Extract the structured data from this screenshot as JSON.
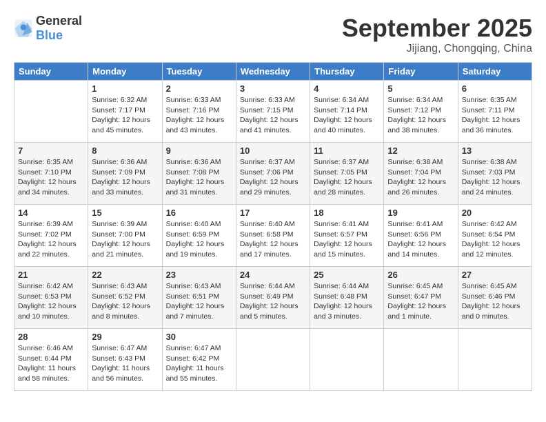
{
  "logo": {
    "general": "General",
    "blue": "Blue"
  },
  "title": "September 2025",
  "subtitle": "Jijiang, Chongqing, China",
  "days_of_week": [
    "Sunday",
    "Monday",
    "Tuesday",
    "Wednesday",
    "Thursday",
    "Friday",
    "Saturday"
  ],
  "weeks": [
    [
      {
        "day": "",
        "info": ""
      },
      {
        "day": "1",
        "info": "Sunrise: 6:32 AM\nSunset: 7:17 PM\nDaylight: 12 hours\nand 45 minutes."
      },
      {
        "day": "2",
        "info": "Sunrise: 6:33 AM\nSunset: 7:16 PM\nDaylight: 12 hours\nand 43 minutes."
      },
      {
        "day": "3",
        "info": "Sunrise: 6:33 AM\nSunset: 7:15 PM\nDaylight: 12 hours\nand 41 minutes."
      },
      {
        "day": "4",
        "info": "Sunrise: 6:34 AM\nSunset: 7:14 PM\nDaylight: 12 hours\nand 40 minutes."
      },
      {
        "day": "5",
        "info": "Sunrise: 6:34 AM\nSunset: 7:12 PM\nDaylight: 12 hours\nand 38 minutes."
      },
      {
        "day": "6",
        "info": "Sunrise: 6:35 AM\nSunset: 7:11 PM\nDaylight: 12 hours\nand 36 minutes."
      }
    ],
    [
      {
        "day": "7",
        "info": "Sunrise: 6:35 AM\nSunset: 7:10 PM\nDaylight: 12 hours\nand 34 minutes."
      },
      {
        "day": "8",
        "info": "Sunrise: 6:36 AM\nSunset: 7:09 PM\nDaylight: 12 hours\nand 33 minutes."
      },
      {
        "day": "9",
        "info": "Sunrise: 6:36 AM\nSunset: 7:08 PM\nDaylight: 12 hours\nand 31 minutes."
      },
      {
        "day": "10",
        "info": "Sunrise: 6:37 AM\nSunset: 7:06 PM\nDaylight: 12 hours\nand 29 minutes."
      },
      {
        "day": "11",
        "info": "Sunrise: 6:37 AM\nSunset: 7:05 PM\nDaylight: 12 hours\nand 28 minutes."
      },
      {
        "day": "12",
        "info": "Sunrise: 6:38 AM\nSunset: 7:04 PM\nDaylight: 12 hours\nand 26 minutes."
      },
      {
        "day": "13",
        "info": "Sunrise: 6:38 AM\nSunset: 7:03 PM\nDaylight: 12 hours\nand 24 minutes."
      }
    ],
    [
      {
        "day": "14",
        "info": "Sunrise: 6:39 AM\nSunset: 7:02 PM\nDaylight: 12 hours\nand 22 minutes."
      },
      {
        "day": "15",
        "info": "Sunrise: 6:39 AM\nSunset: 7:00 PM\nDaylight: 12 hours\nand 21 minutes."
      },
      {
        "day": "16",
        "info": "Sunrise: 6:40 AM\nSunset: 6:59 PM\nDaylight: 12 hours\nand 19 minutes."
      },
      {
        "day": "17",
        "info": "Sunrise: 6:40 AM\nSunset: 6:58 PM\nDaylight: 12 hours\nand 17 minutes."
      },
      {
        "day": "18",
        "info": "Sunrise: 6:41 AM\nSunset: 6:57 PM\nDaylight: 12 hours\nand 15 minutes."
      },
      {
        "day": "19",
        "info": "Sunrise: 6:41 AM\nSunset: 6:56 PM\nDaylight: 12 hours\nand 14 minutes."
      },
      {
        "day": "20",
        "info": "Sunrise: 6:42 AM\nSunset: 6:54 PM\nDaylight: 12 hours\nand 12 minutes."
      }
    ],
    [
      {
        "day": "21",
        "info": "Sunrise: 6:42 AM\nSunset: 6:53 PM\nDaylight: 12 hours\nand 10 minutes."
      },
      {
        "day": "22",
        "info": "Sunrise: 6:43 AM\nSunset: 6:52 PM\nDaylight: 12 hours\nand 8 minutes."
      },
      {
        "day": "23",
        "info": "Sunrise: 6:43 AM\nSunset: 6:51 PM\nDaylight: 12 hours\nand 7 minutes."
      },
      {
        "day": "24",
        "info": "Sunrise: 6:44 AM\nSunset: 6:49 PM\nDaylight: 12 hours\nand 5 minutes."
      },
      {
        "day": "25",
        "info": "Sunrise: 6:44 AM\nSunset: 6:48 PM\nDaylight: 12 hours\nand 3 minutes."
      },
      {
        "day": "26",
        "info": "Sunrise: 6:45 AM\nSunset: 6:47 PM\nDaylight: 12 hours\nand 1 minute."
      },
      {
        "day": "27",
        "info": "Sunrise: 6:45 AM\nSunset: 6:46 PM\nDaylight: 12 hours\nand 0 minutes."
      }
    ],
    [
      {
        "day": "28",
        "info": "Sunrise: 6:46 AM\nSunset: 6:44 PM\nDaylight: 11 hours\nand 58 minutes."
      },
      {
        "day": "29",
        "info": "Sunrise: 6:47 AM\nSunset: 6:43 PM\nDaylight: 11 hours\nand 56 minutes."
      },
      {
        "day": "30",
        "info": "Sunrise: 6:47 AM\nSunset: 6:42 PM\nDaylight: 11 hours\nand 55 minutes."
      },
      {
        "day": "",
        "info": ""
      },
      {
        "day": "",
        "info": ""
      },
      {
        "day": "",
        "info": ""
      },
      {
        "day": "",
        "info": ""
      }
    ]
  ]
}
